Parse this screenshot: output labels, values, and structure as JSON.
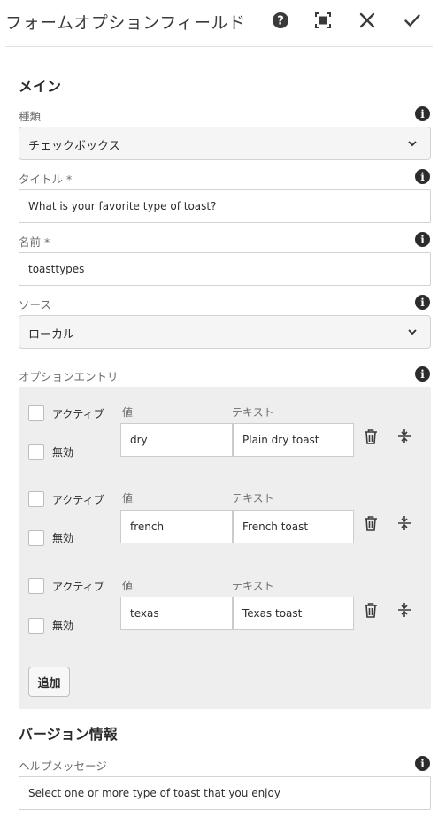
{
  "header": {
    "title": "フォームオプションフィールド",
    "icons": [
      "help-icon",
      "fullscreen-icon",
      "close-icon",
      "check-icon"
    ]
  },
  "main": {
    "section_title": "メイン",
    "type": {
      "label": "種類",
      "value": "チェックボックス"
    },
    "title_field": {
      "label": "タイトル *",
      "value": "What is your favorite type of toast?"
    },
    "name_field": {
      "label": "名前 *",
      "value": "toasttypes"
    },
    "source": {
      "label": "ソース",
      "value": "ローカル"
    },
    "options": {
      "label": "オプションエントリ",
      "active_label": "アクティブ",
      "disabled_label": "無効",
      "value_col": "値",
      "text_col": "テキスト",
      "entries": [
        {
          "value": "dry",
          "text": "Plain dry toast",
          "active": false,
          "disabled": false
        },
        {
          "value": "french",
          "text": "French toast",
          "active": false,
          "disabled": false
        },
        {
          "value": "texas",
          "text": "Texas toast",
          "active": false,
          "disabled": false
        }
      ],
      "add_label": "追加"
    }
  },
  "version": {
    "section_title": "バージョン情報",
    "help": {
      "label": "ヘルプメッセージ",
      "value": "Select one or more type of toast that you enjoy"
    }
  },
  "colors": {
    "text": "#2c2c2c",
    "label": "#6e6e6e",
    "panel": "#eeeeee",
    "border": "#d3d3d3"
  }
}
